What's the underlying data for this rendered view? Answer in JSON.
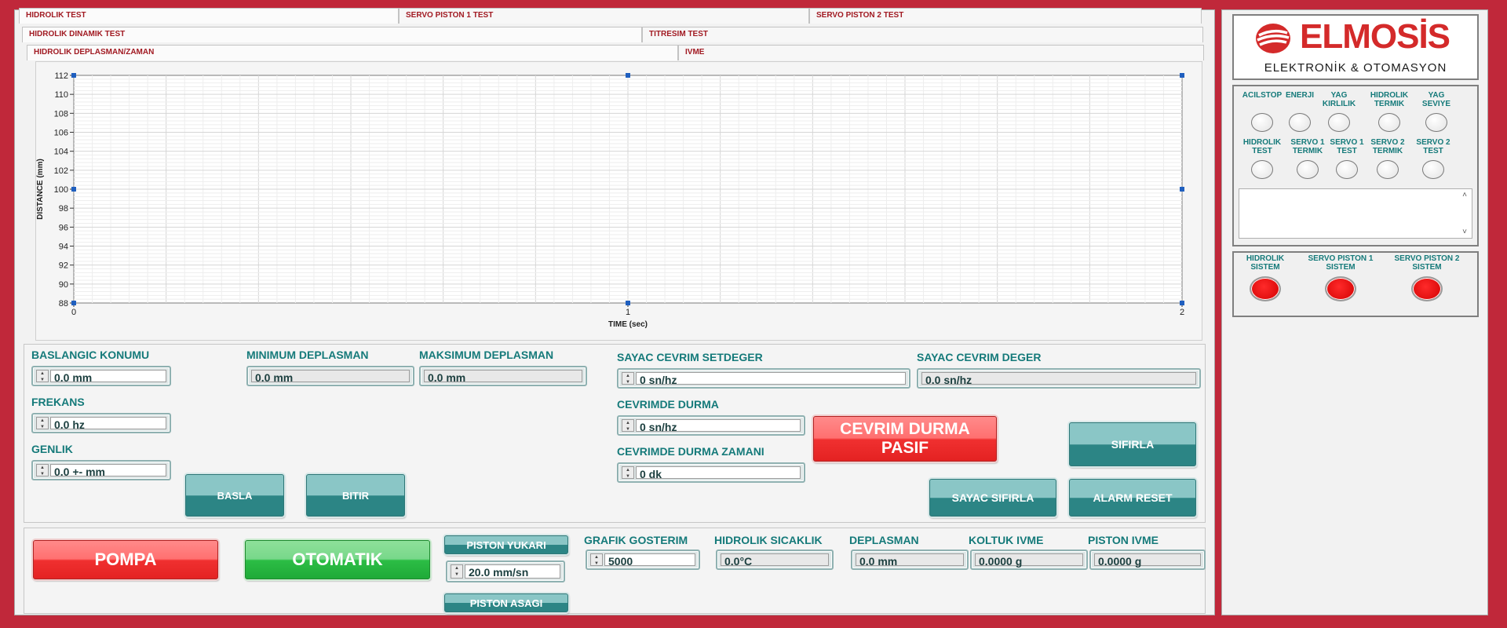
{
  "tabs_row1": [
    "HIDROLIK TEST",
    "SERVO PISTON 1 TEST",
    "SERVO PISTON 2 TEST"
  ],
  "tabs_row2": [
    "HIDROLIK DINAMIK TEST",
    "TITRESIM TEST"
  ],
  "tabs_row3": [
    "HIDROLIK DEPLASMAN/ZAMAN",
    "IVME"
  ],
  "chart_data": {
    "type": "line",
    "title": "",
    "xlabel": "TIME (sec)",
    "ylabel": "DISTANCE (mm)",
    "xlim": [
      0,
      2
    ],
    "ylim": [
      88,
      112
    ],
    "xticks": [
      0,
      1,
      2
    ],
    "yticks": [
      88,
      90,
      92,
      94,
      96,
      98,
      100,
      102,
      104,
      106,
      108,
      110,
      112
    ],
    "grid": true,
    "series": []
  },
  "params": {
    "baslangic_label": "BASLANGIC KONUMU",
    "baslangic_value": "0.0  mm",
    "frekans_label": "FREKANS",
    "frekans_value": "0.0 hz",
    "genlik_label": "GENLIK",
    "genlik_value": "0.0  +- mm",
    "min_label": "MINIMUM DEPLASMAN",
    "min_value": "0.0  mm",
    "max_label": "MAKSIMUM DEPLASMAN",
    "max_value": "0.0  mm",
    "sayac_set_label": "SAYAC CEVRIM SETDEGER",
    "sayac_set_value": "0 sn/hz",
    "sayac_deger_label": "SAYAC CEVRIM DEGER",
    "sayac_deger_value": "0.0  sn/hz",
    "cevrimde_durma_label": "CEVRIMDE DURMA",
    "cevrimde_durma_value": "0  sn/hz",
    "cevrimde_zaman_label": "CEVRIMDE DURMA ZAMANI",
    "cevrimde_zaman_value": "0  dk"
  },
  "buttons": {
    "basla": "BASLA",
    "bitir": "BITIR",
    "cevrim_durma_1": "CEVRIM DURMA",
    "cevrim_durma_2": "PASIF",
    "sifirla": "SIFIRLA",
    "sayac_sifirla": "SAYAC SIFIRLA",
    "alarm_reset": "ALARM RESET",
    "pompa": "POMPA",
    "otomatik": "OTOMATIK",
    "piston_yukari": "PISTON YUKARI",
    "piston_asagi": "PISTON ASAGI"
  },
  "bottom": {
    "piston_speed": "20.0  mm/sn",
    "grafik_label": "GRAFIK GOSTERIM",
    "grafik_value": "5000",
    "sicaklik_label": "HIDROLIK SICAKLIK",
    "sicaklik_value": "0.0°C",
    "deplasman_label": "DEPLASMAN",
    "deplasman_value": "0.0  mm",
    "koltuk_label": "KOLTUK IVME",
    "koltuk_value": "0.0000  g",
    "piston_ivme_label": "PISTON IVME",
    "piston_ivme_value": "0.0000  g"
  },
  "logo": {
    "brand": "ELMOSİS",
    "subtitle": "ELEKTRONİK & OTOMASYON"
  },
  "indicators_row1": [
    "ACILSTOP",
    "ENERJI",
    "YAG\nKIRLILIK",
    "HIDROLIK\nTERMIK",
    "YAG\nSEVIYE"
  ],
  "indicators_row2": [
    "HIDROLIK\nTEST",
    "SERVO 1\nTERMIK",
    "SERVO 1\nTEST",
    "SERVO 2\nTERMIK",
    "SERVO 2\nTEST"
  ],
  "systems": [
    "HIDROLIK\nSISTEM",
    "SERVO PISTON 1\nSISTEM",
    "SERVO PISTON 2\nSISTEM"
  ],
  "colors": {
    "frame": "#c0283a",
    "teal": "#157a7a",
    "tab_text": "#a11a22",
    "led_on": "#ff1a1a"
  }
}
